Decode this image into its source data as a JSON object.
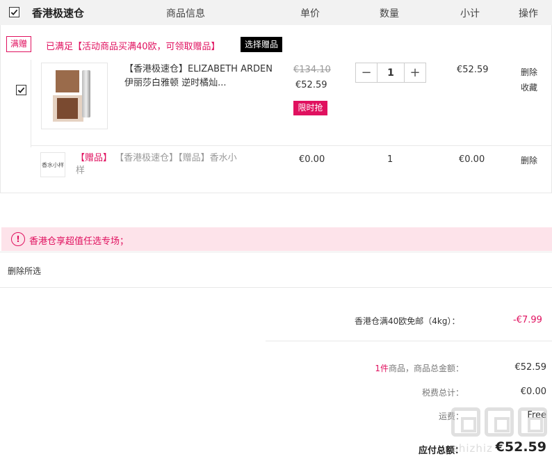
{
  "header": {
    "warehouse": "香港极速仓",
    "col_product": "商品信息",
    "col_price": "单价",
    "col_qty": "数量",
    "col_subtotal": "小计",
    "col_action": "操作"
  },
  "promo": {
    "tag": "满赠",
    "text": "已满足【活动商品买满40欧，可领取赠品】",
    "gift_button": "选择赠品"
  },
  "item": {
    "name": "【香港极速仓】ELIZABETH ARDEN 伊丽莎白雅顿 逆时橘灿...",
    "original_price": "€134.10",
    "price": "€52.59",
    "flash_badge": "限时抢",
    "qty_minus": "−",
    "qty_value": "1",
    "qty_plus": "+",
    "subtotal": "€52.59",
    "action_delete": "删除",
    "action_favorite": "收藏"
  },
  "gift": {
    "thumb_text": "香水小样",
    "tag": "【赠品】",
    "name": "【香港极速仓】【赠品】香水小样",
    "price": "€0.00",
    "qty": "1",
    "subtotal": "€0.00",
    "action_delete": "删除"
  },
  "notice": {
    "icon": "!",
    "text": "香港仓享超值任选专场；"
  },
  "bulk": {
    "delete_selected": "删除所选"
  },
  "summary": {
    "shipping_label": "香港仓满40欧免邮（4kg）：",
    "shipping_value": "-€7.99",
    "count": "1件",
    "count_label": "商品，商品总金额：",
    "goods_total": "€52.59",
    "tax_label": "税费总计：",
    "tax_value": "€0.00",
    "freight_label": "运费：",
    "freight_value": "Free",
    "total_label": "应付总额：",
    "total_value": "€52.59"
  },
  "watermark": {
    "text": "shizhiz"
  },
  "colors": {
    "accent": "#e0115f",
    "notice_bg": "#fde3ea",
    "header_bg": "#f2f2f2"
  }
}
